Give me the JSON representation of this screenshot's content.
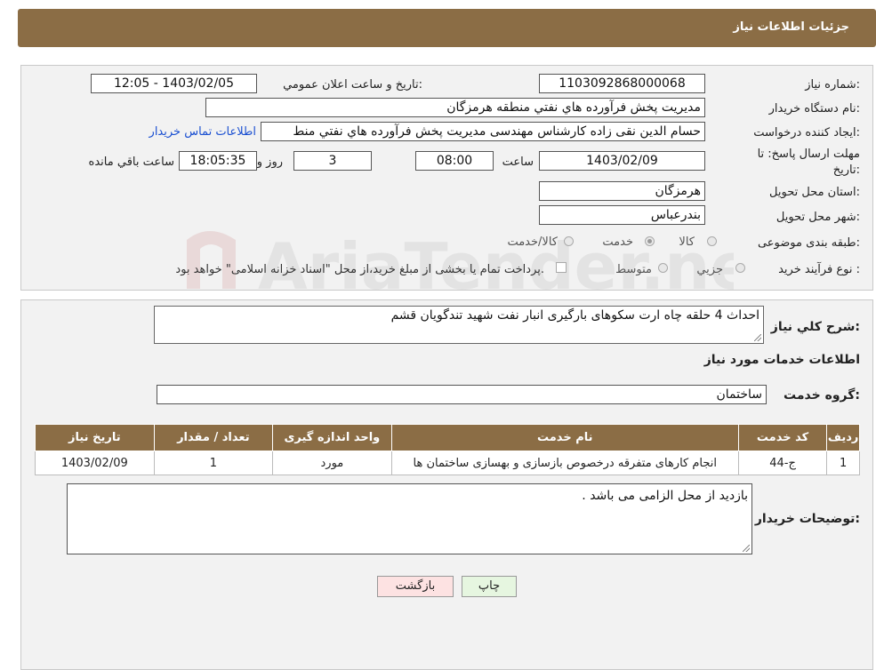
{
  "page_title": "جزئیات اطلاعات نیاز",
  "watermark": "AriaTender.neT",
  "form": {
    "need_number_label": "شماره نیاز:",
    "need_number": "1103092868000068",
    "announce_label": "تاریخ و ساعت اعلان عمومي:",
    "announce_value": "1403/02/05 - 12:05",
    "buyer_org_label": "نام دستگاه خريدار:",
    "buyer_org": "مديريت پخش فرآورده هاي نفتي منطقه هرمزگان",
    "creator_label": "ايجاد کننده درخواست:",
    "creator": "حسام الدين نقی زاده کارشناس مهندسی مديريت پخش فرآورده هاي نفتي منط",
    "contact_link": "اطلاعات تماس خريدار",
    "deadline_label_line1": "مهلت ارسال پاسخ: تا",
    "deadline_label_line2": "تاریخ:",
    "deadline_date": "1403/02/09",
    "time_label": "ساعت",
    "deadline_time": "08:00",
    "days": "3",
    "days_label": "روز و",
    "remaining_time": "18:05:35",
    "remaining_label": "ساعت باقي مانده",
    "province_label": "استان محل تحویل:",
    "province": "هرمزگان",
    "city_label": "شهر محل تحویل:",
    "city": "بندرعباس",
    "category_label": "طبقه بندی موضوعی:",
    "category_options": [
      "کالا",
      "خدمت",
      "کالا/خدمت"
    ],
    "category_selected": "خدمت",
    "purchase_type_label": "نوع فرآیند خرید :",
    "purchase_options": [
      "جزيي",
      "متوسط"
    ],
    "payment_note": "پرداخت تمام يا بخشی از مبلغ خريد،از محل \"اسناد خزانه اسلامی\" خواهد بود."
  },
  "description": {
    "label": "شرح کلي نياز:",
    "value": "احداث 4 حلقه چاه ارت سکوهای بارگیری انبار نفت شهید تندگویان قشم"
  },
  "services": {
    "section_title": "اطلاعات خدمات مورد نیاز",
    "group_label": "گروه خدمت:",
    "group_value": "ساختمان",
    "columns": [
      "رديف",
      "کد خدمت",
      "نام خدمت",
      "واحد اندازه گيری",
      "تعداد / مقدار",
      "تاريخ نياز"
    ],
    "rows": [
      [
        "1",
        "ج-44",
        "انجام کارهای متفرقه درخصوص بازسازی و بهسازی ساختمان ها",
        "مورد",
        "1",
        "1403/02/09"
      ]
    ]
  },
  "buyer_notes": {
    "label": "توضيحات خريدار:",
    "value": "بازدید از محل الزامی می باشد ."
  },
  "buttons": {
    "print": "چاپ",
    "back": "بازگشت"
  },
  "colors": {
    "header_brown": "#8b6d45",
    "back_button_bg": "#fde2e2",
    "print_button_bg": "#e6f6e0",
    "link_blue": "#1a4fd1"
  }
}
